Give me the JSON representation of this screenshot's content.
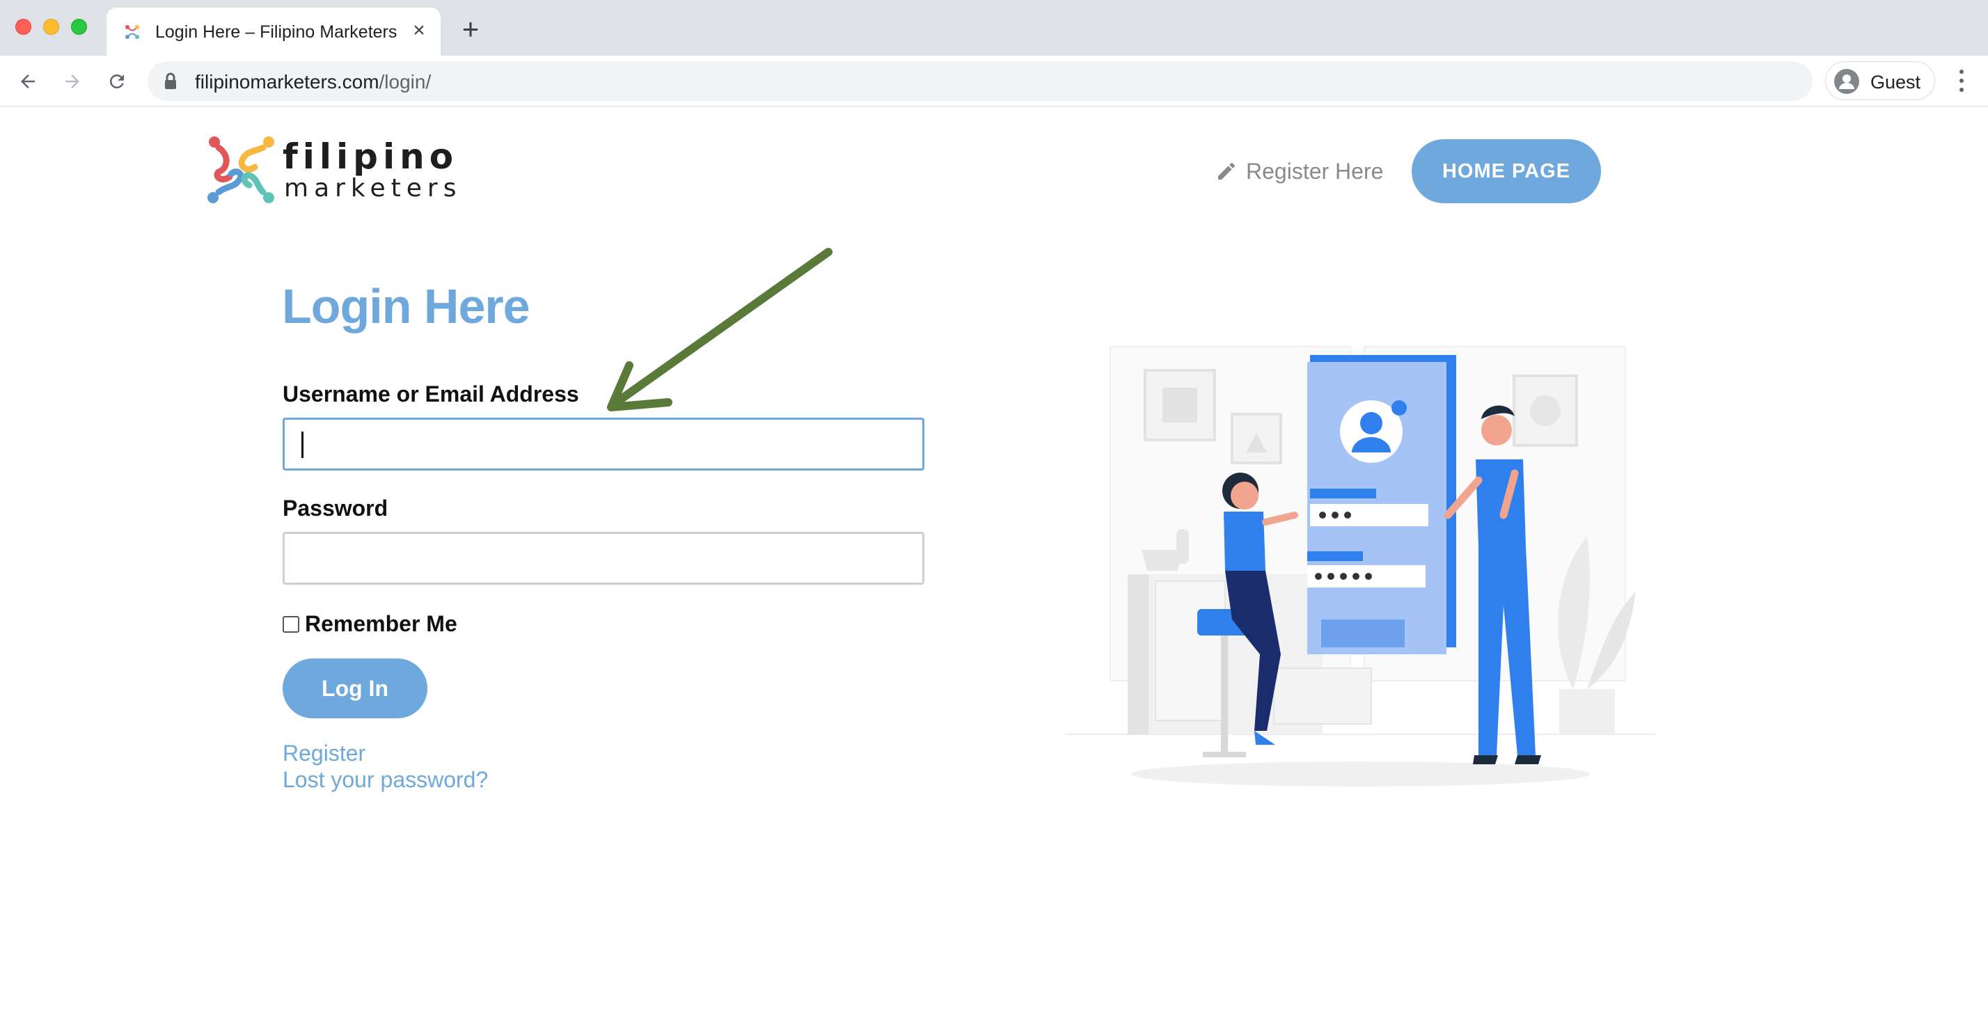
{
  "browser": {
    "tab_title": "Login Here – Filipino Marketers",
    "tab_close": "×",
    "new_tab": "+",
    "url_domain": "filipinomarketers.com",
    "url_path": "/login/",
    "profile_label": "Guest"
  },
  "header": {
    "logo_word1": "filipino",
    "logo_word2": "marketers",
    "register_link": "Register Here",
    "home_button": "HOME PAGE"
  },
  "login_form": {
    "title": "Login Here",
    "username_label": "Username or Email Address",
    "username_value": "",
    "password_label": "Password",
    "password_value": "",
    "remember_label": "Remember Me",
    "remember_checked": false,
    "submit_label": "Log In",
    "register_link": "Register",
    "lost_password_link": "Lost your password?"
  },
  "colors": {
    "accent": "#6ea8dc",
    "arrow": "#5a7a3a",
    "illustration_blue": "#2f80ed"
  },
  "icons": [
    "back-arrow-icon",
    "forward-arrow-icon",
    "reload-icon",
    "lock-icon",
    "profile-avatar-icon",
    "menu-dots-icon",
    "pencil-icon"
  ]
}
